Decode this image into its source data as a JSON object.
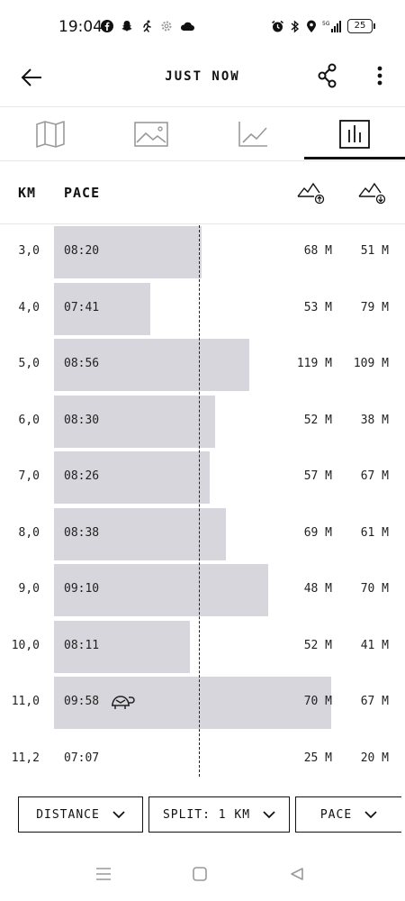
{
  "status_bar": {
    "time": "19:04",
    "battery": "25",
    "left_icons": [
      "facebook-icon",
      "snapchat-icon",
      "running-icon",
      "settings-icon",
      "cloud-icon"
    ],
    "right_icons": [
      "alarm-icon",
      "bluetooth-icon",
      "location-icon",
      "signal-5g-icon",
      "battery-icon"
    ]
  },
  "app_bar": {
    "title": "JUST NOW",
    "icons": [
      "back-arrow-icon",
      "share-icon",
      "more-vertical-icon"
    ]
  },
  "tabs": [
    {
      "icon": "map-icon",
      "selected": false
    },
    {
      "icon": "image-icon",
      "selected": false
    },
    {
      "icon": "line-chart-icon",
      "selected": false
    },
    {
      "icon": "bar-chart-icon",
      "selected": true
    }
  ],
  "table": {
    "headers": {
      "km": "KM",
      "pace": "PACE",
      "ascent_icon": "elevation-gain-icon",
      "descent_icon": "elevation-loss-icon"
    },
    "average_pace_seconds": 498,
    "rows": [
      {
        "km": "3,0",
        "pace": "08:20",
        "pace_seconds": 500,
        "ascent": "68 M",
        "descent": "51 M"
      },
      {
        "km": "4,0",
        "pace": "07:41",
        "pace_seconds": 461,
        "ascent": "53 M",
        "descent": "79 M"
      },
      {
        "km": "5,0",
        "pace": "08:56",
        "pace_seconds": 536,
        "ascent": "119 M",
        "descent": "109 M"
      },
      {
        "km": "6,0",
        "pace": "08:30",
        "pace_seconds": 510,
        "ascent": "52 M",
        "descent": "38 M"
      },
      {
        "km": "7,0",
        "pace": "08:26",
        "pace_seconds": 506,
        "ascent": "57 M",
        "descent": "67 M"
      },
      {
        "km": "8,0",
        "pace": "08:38",
        "pace_seconds": 518,
        "ascent": "69 M",
        "descent": "61 M"
      },
      {
        "km": "9,0",
        "pace": "09:10",
        "pace_seconds": 550,
        "ascent": "48 M",
        "descent": "70 M"
      },
      {
        "km": "10,0",
        "pace": "08:11",
        "pace_seconds": 491,
        "ascent": "52 M",
        "descent": "41 M"
      },
      {
        "km": "11,0",
        "pace": "09:58",
        "pace_seconds": 598,
        "ascent": "70 M",
        "descent": "67 M",
        "slowest": true
      },
      {
        "km": "11,2",
        "pace": "07:07",
        "pace_seconds": 427,
        "ascent": "25 M",
        "descent": "20 M",
        "partial": true
      }
    ]
  },
  "filters": {
    "distance": "DISTANCE",
    "split": "SPLIT: 1 KM",
    "pace": "PACE"
  },
  "nav_bar": {
    "icons": [
      "recent-apps-icon",
      "home-icon",
      "back-triangle-icon"
    ]
  },
  "colors": {
    "bar": "#d6d6dc",
    "text": "#111111",
    "background": "#ffffff"
  }
}
